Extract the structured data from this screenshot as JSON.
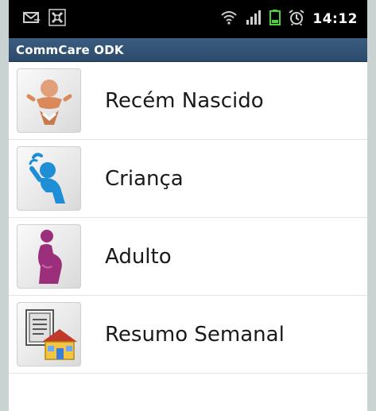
{
  "status_bar": {
    "time": "14:12",
    "left_icons": [
      "email-icon",
      "sync-icon"
    ],
    "right_icons": [
      "wifi-icon",
      "signal-icon",
      "battery-icon",
      "alarm-icon"
    ]
  },
  "app": {
    "title": "CommCare ODK"
  },
  "menu": {
    "items": [
      {
        "label": "Recém Nascido",
        "icon": "newborn-icon",
        "color": "#d9895a"
      },
      {
        "label": "Criança",
        "icon": "child-icon",
        "color": "#1e8fd6"
      },
      {
        "label": "Adulto",
        "icon": "pregnant-woman-icon",
        "color": "#9b2f7c"
      },
      {
        "label": "Resumo Semanal",
        "icon": "weekly-summary-icon",
        "color": "#c0392b"
      }
    ]
  },
  "colors": {
    "title_bar": "#2f4f73",
    "status_bar": "#000000",
    "battery": "#4cd137"
  }
}
